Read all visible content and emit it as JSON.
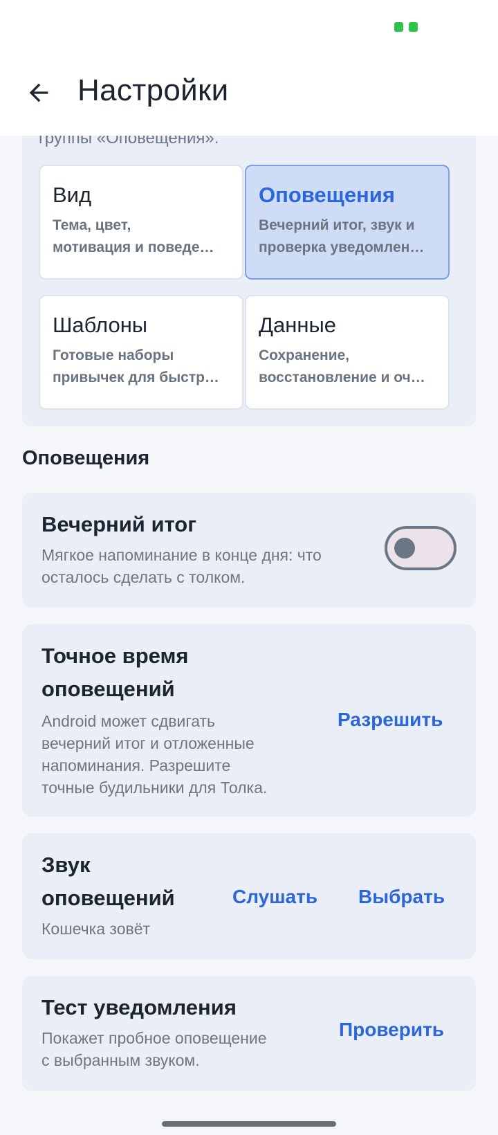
{
  "status_bar": {
    "indicator_color": "#2ec44a"
  },
  "app_bar": {
    "back_icon": "arrow-left-icon",
    "title": "Настройки"
  },
  "overview": {
    "caption": "группы «Оповещения».",
    "cards": [
      {
        "title": "Вид",
        "desc_line1": "Тема, цвет,",
        "desc_line2": "мотивация и поведе…",
        "active": false
      },
      {
        "title": "Оповещения",
        "desc_line1": "Вечерний итог, звук и",
        "desc_line2": "проверка уведомлен…",
        "active": true
      },
      {
        "title": "Шаблоны",
        "desc_line1": "Готовые наборы",
        "desc_line2": "привычек для быстр…",
        "active": false
      },
      {
        "title": "Данные",
        "desc_line1": "Сохранение,",
        "desc_line2": "восстановление и оч…",
        "active": false
      }
    ]
  },
  "section": {
    "heading": "Оповещения"
  },
  "evening_summary": {
    "title": "Вечерний итог",
    "desc_line1": "Мягкое напоминание в конце дня: что",
    "desc_line2": "осталось сделать с толком.",
    "toggle_on": false
  },
  "exact_time": {
    "title_line1": "Точное время",
    "title_line2": "оповещений",
    "desc_line1": "Android может сдвигать",
    "desc_line2": "вечерний итог и отложенные",
    "desc_line3": "напоминания. Разрешите",
    "desc_line4": "точные будильники для Толка.",
    "action": "Разрешить"
  },
  "sound": {
    "title_line1": "Звук",
    "title_line2": "оповещений",
    "value": "Кошечка зовёт",
    "listen": "Слушать",
    "choose": "Выбрать"
  },
  "test": {
    "title": "Тест уведомления",
    "desc_line1": "Покажет пробное оповещение",
    "desc_line2": "с выбранным звуком.",
    "action": "Проверить"
  },
  "colors": {
    "accent": "#2c66d8",
    "card_bg": "#eaeef6",
    "active_card_bg": "#cfdcf5"
  }
}
